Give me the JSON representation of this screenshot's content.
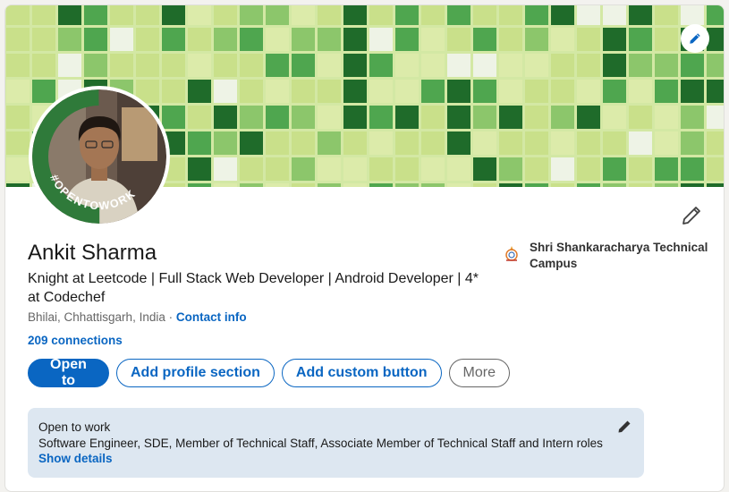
{
  "profile": {
    "name": "Ankit Sharma",
    "headline": "Knight at Leetcode | Full Stack Web Developer | Android Developer | 4* at Codechef",
    "location": "Bhilai, Chhattisgarh, India",
    "location_separator": " · ",
    "contact_info_label": "Contact info",
    "connections_label": "209 connections",
    "open_to_work_badge": "#OPENTOWORK"
  },
  "education": {
    "school_name": "Shri Shankaracharya Technical Campus",
    "logo_icon": "school-logo"
  },
  "actions": {
    "open_to_label": "Open to",
    "add_section_label": "Add profile section",
    "custom_button_label": "Add custom button",
    "more_label": "More"
  },
  "open_to_work_card": {
    "title": "Open to work",
    "roles": "Software Engineer, SDE, Member of Technical Staff, Associate Member of Technical Staff and Intern roles",
    "show_details_label": "Show details"
  },
  "colors": {
    "accent": "#0a66c2",
    "open_to_work_green": "#2f7a3a",
    "banner_palette": [
      "#1f6b2a",
      "#4fa64f",
      "#8cc66b",
      "#c9e08a",
      "#dcebaa",
      "#eef3e6"
    ]
  },
  "icons": {
    "banner_edit": "pencil-icon",
    "intro_edit": "pencil-icon",
    "open_to_work_edit": "pencil-icon"
  }
}
